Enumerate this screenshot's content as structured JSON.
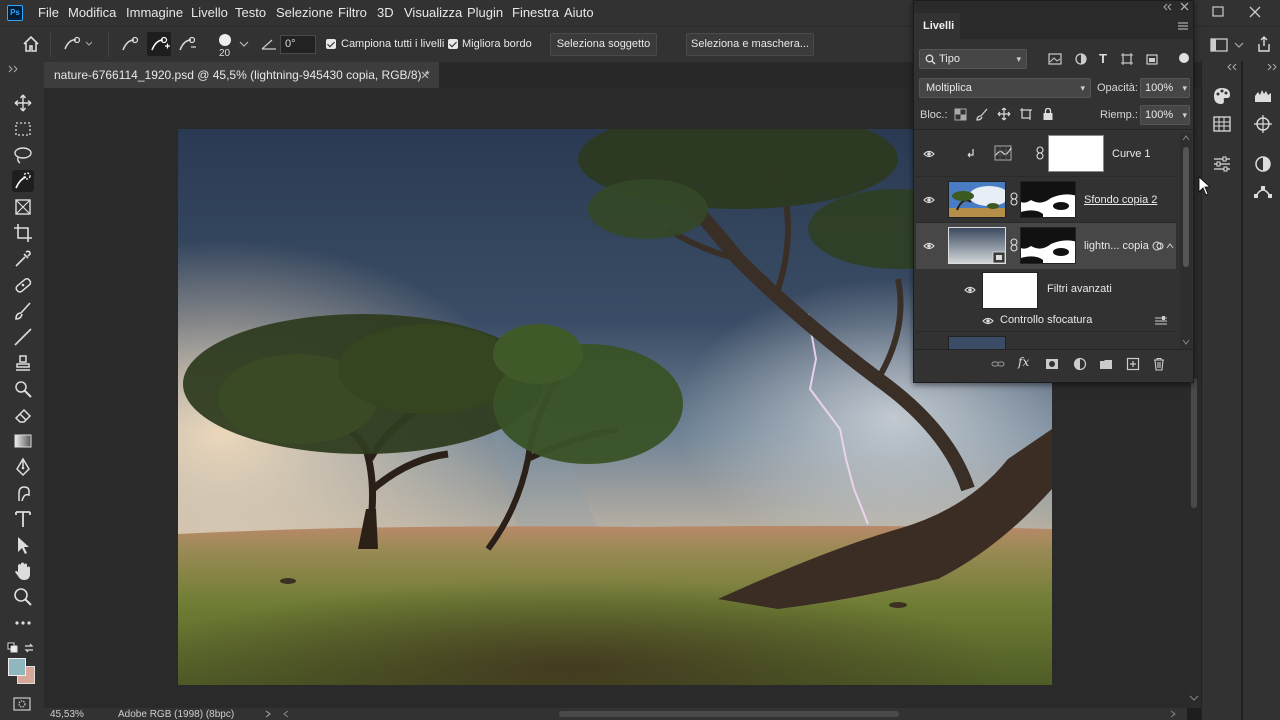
{
  "menubar": {
    "logo": "Ps",
    "items": [
      "File",
      "Modifica",
      "Immagine",
      "Livello",
      "Testo",
      "Selezione",
      "Filtro",
      "3D",
      "Visualizza",
      "Plugin",
      "Finestra",
      "Aiuto"
    ]
  },
  "options": {
    "brush_size": "20",
    "angle": "0°",
    "sample_all_label": "Campiona tutti i livelli",
    "enhance_edge_label": "Migliora bordo",
    "select_subject_label": "Seleziona soggetto",
    "select_mask_label": "Seleziona e maschera..."
  },
  "document": {
    "tab_title": "nature-6766114_1920.psd @ 45,5% (lightning-945430 copia, RGB/8) *",
    "zoom": "45,53%",
    "profile": "Adobe RGB (1998) (8bpc)"
  },
  "layers_panel": {
    "title": "Livelli",
    "filter_label": "Tipo",
    "blend_mode": "Moltiplica",
    "opacity_label": "Opacità:",
    "opacity_value": "100%",
    "lock_label": "Bloc.:",
    "fill_label": "Riemp.:",
    "fill_value": "100%",
    "layers": [
      {
        "name": "Curve 1"
      },
      {
        "name": "Sfondo copia 2"
      },
      {
        "name": "lightn... copia"
      }
    ],
    "smart_filters_label": "Filtri avanzati",
    "filter_item_label": "Controllo sfocatura"
  },
  "colors": {
    "foreground": "#8fb7bd",
    "background": "#d7a79a",
    "accent": "#31a8ff"
  }
}
